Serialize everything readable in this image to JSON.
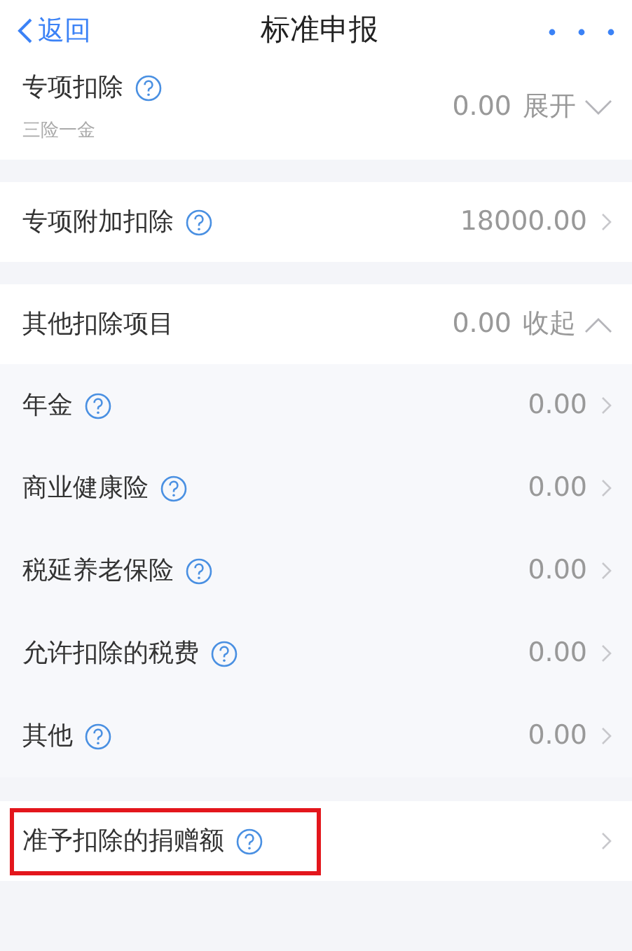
{
  "nav": {
    "back": "返回",
    "title": "标准申报"
  },
  "sections": [
    {
      "kind": "expandable",
      "label": "专项扣除",
      "help": true,
      "subtitle": "三险一金",
      "value": "0.00",
      "toggle": "展开",
      "expanded": false
    },
    {
      "kind": "link",
      "label": "专项附加扣除",
      "help": true,
      "value": "18000.00"
    },
    {
      "kind": "expandable",
      "label": "其他扣除项目",
      "help": false,
      "value": "0.00",
      "toggle": "收起",
      "expanded": true,
      "children": [
        {
          "label": "年金",
          "help": true,
          "value": "0.00"
        },
        {
          "label": "商业健康险",
          "help": true,
          "value": "0.00"
        },
        {
          "label": "税延养老保险",
          "help": true,
          "value": "0.00"
        },
        {
          "label": "允许扣除的税费",
          "help": true,
          "value": "0.00"
        },
        {
          "label": "其他",
          "help": true,
          "value": "0.00"
        }
      ]
    },
    {
      "kind": "link",
      "label": "准予扣除的捐赠额",
      "help": true,
      "highlighted": true
    }
  ]
}
